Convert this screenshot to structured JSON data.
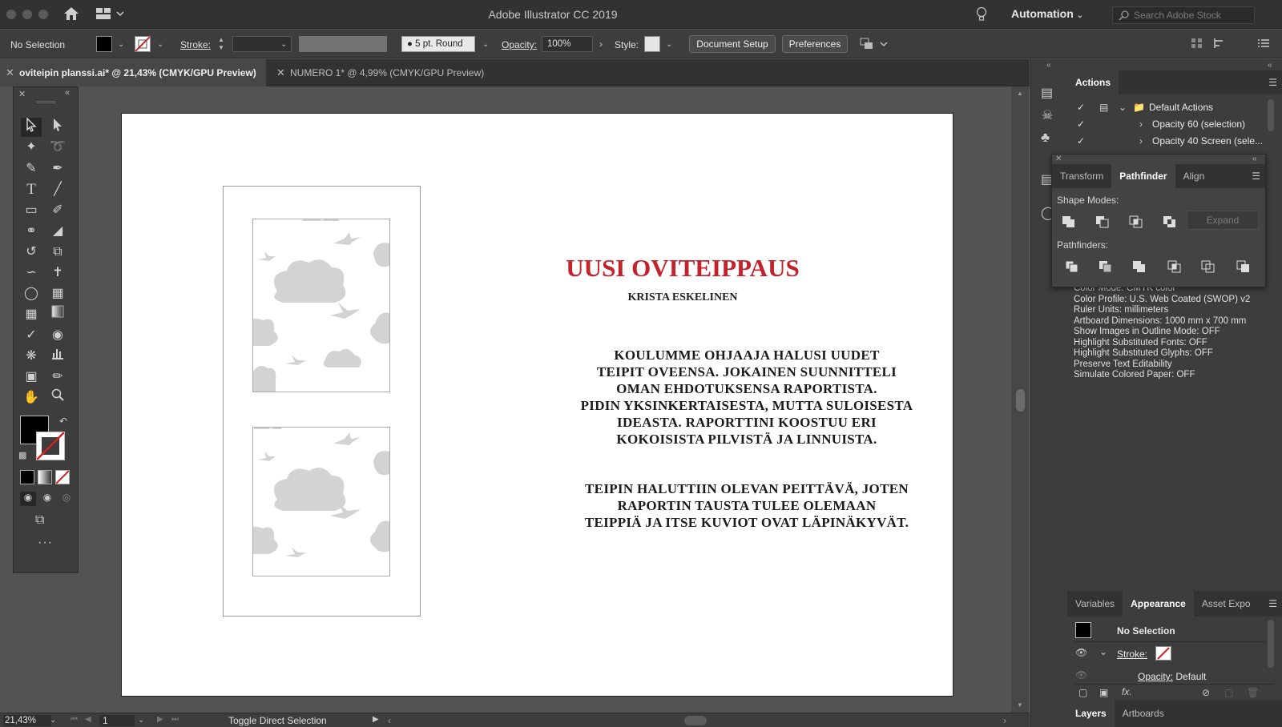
{
  "app": {
    "title": "Adobe Illustrator CC 2019",
    "workspace": "Automation",
    "search_placeholder": "Search Adobe Stock"
  },
  "control": {
    "selection": "No Selection",
    "stroke_label": "Stroke:",
    "brush": "5 pt. Round",
    "opacity_label": "Opacity:",
    "opacity_value": "100%",
    "style_label": "Style:",
    "document_setup": "Document Setup",
    "preferences": "Preferences"
  },
  "tabs": [
    {
      "label": "oviteipin planssi.ai* @ 21,43% (CMYK/GPU Preview)",
      "active": true
    },
    {
      "label": "NUMERO 1* @ 4,99% (CMYK/GPU Preview)",
      "active": false
    }
  ],
  "artboard": {
    "headline": "UUSI OVITEIPPAUS",
    "author": "KRISTA ESKELINEN",
    "para1": [
      "KOULUMME OHJAAJA HALUSI UUDET",
      "TEIPIT OVEENSA. JOKAINEN SUUNNITTELI",
      "OMAN EHDOTUKSENSA RAPORTISTA.",
      "PIDIN YKSINKERTAISESTA, MUTTA SULOISESTA",
      "IDEASTA. RAPORTTINI KOOSTUU ERI",
      "KOKOISISTA PILVISTÄ JA LINNUISTA."
    ],
    "para2": [
      "TEIPIN HALUTTIIN OLEVAN PEITTÄVÄ, JOTEN",
      "RAPORTIN TAUSTA TULEE OLEMAAN",
      "TEIPPIÄ JA ITSE KUVIOT OVAT LÄPINÄKYVÄT."
    ]
  },
  "actions": {
    "title": "Actions",
    "items": [
      {
        "label": "Default Actions",
        "type": "folder"
      },
      {
        "label": "Opacity 60 (selection)",
        "type": "action"
      },
      {
        "label": "Opacity 40 Screen (sele...",
        "type": "action"
      }
    ]
  },
  "pathfinder": {
    "tabs": [
      "Transform",
      "Pathfinder",
      "Align"
    ],
    "active": "Pathfinder",
    "shape_modes": "Shape Modes:",
    "expand": "Expand",
    "pathfinders": "Pathfinders:"
  },
  "docinfo": [
    "Color Mode: CMYK color",
    "Color Profile: U.S. Web Coated (SWOP) v2",
    "Ruler Units: millimeters",
    "Artboard Dimensions: 1000 mm x 700 mm",
    "Show Images in Outline Mode: OFF",
    "Highlight Substituted Fonts: OFF",
    "Highlight Substituted Glyphs: OFF",
    "Preserve Text Editability",
    "Simulate Colored Paper: OFF"
  ],
  "appearance": {
    "tabs": [
      "Variables",
      "Appearance",
      "Asset Expo"
    ],
    "active": "Appearance",
    "no_selection": "No Selection",
    "stroke": "Stroke:",
    "opacity": "Opacity:",
    "opacity_value": "Default"
  },
  "layers_tabs": [
    "Layers",
    "Artboards"
  ],
  "status": {
    "zoom": "21,43%",
    "artboard_num": "1",
    "tool_hint": "Toggle Direct Selection"
  },
  "colors": {
    "accent_red": "#c3222b",
    "ui_bg": "#535353",
    "panel": "#3d3d3d"
  }
}
